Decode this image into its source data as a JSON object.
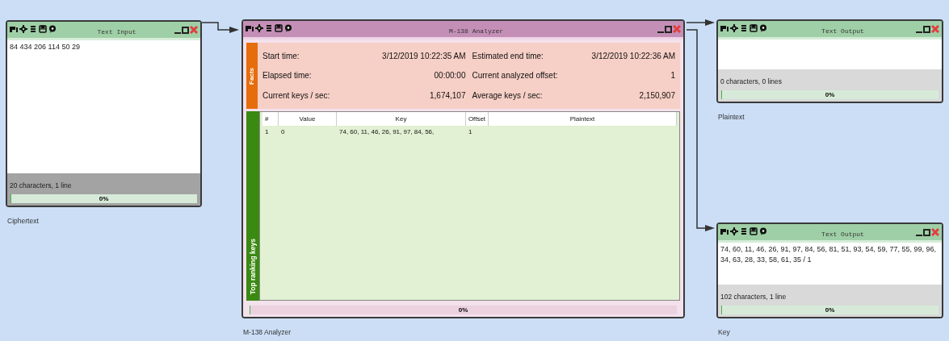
{
  "windows": [
    {
      "kind": "text_input",
      "title": "Text Input",
      "caption": "Ciphertext",
      "text": "84 434 206 114 50 29",
      "status": "20 characters,  1 line",
      "progress": {
        "label": "0%",
        "level": 0
      }
    },
    {
      "kind": "analyzer",
      "title": "M-138 Analyzer",
      "caption": "M-138 Analyzer",
      "facts_tab": "Facts",
      "facts": [
        {
          "label": "Start time:",
          "value": "3/12/2019 10:22:35 AM"
        },
        {
          "label": "Estimated end time:",
          "value": "3/12/2019 10:22:36 AM"
        },
        {
          "label": "Elapsed time:",
          "value": "00:00:00"
        },
        {
          "label": "Current analyzed offset:",
          "value": "1"
        },
        {
          "label": "Current keys / sec:",
          "value": "1,674,107"
        },
        {
          "label": "Average keys / sec:",
          "value": "2,150,907"
        }
      ],
      "keys_tab": "Top ranking keys",
      "table": {
        "columns": [
          "#",
          "Value",
          "Key",
          "Offset",
          "Plaintext"
        ],
        "rows": [
          [
            "1",
            "0",
            "74, 60, 11, 46, 26, 91, 97, 84, 56,",
            "1",
            ""
          ]
        ]
      },
      "progress": {
        "label": "0%",
        "level": 0
      }
    },
    {
      "kind": "text_output",
      "title": "Text Output",
      "caption": "Plaintext",
      "status": "0 characters,  0 lines",
      "progress": {
        "label": "0%",
        "level": 0
      }
    },
    {
      "kind": "text_output",
      "title": "Text Output",
      "caption": "Key",
      "text": "74, 60, 11, 46, 26, 91, 97, 84, 56, 81, 51, 93, 54, 59, 77, 55, 99, 96, 34, 63, 28, 33, 58, 61, 35 / 1",
      "status": "102 characters,  1 line",
      "progress": {
        "label": "0%",
        "level": 0
      }
    }
  ]
}
